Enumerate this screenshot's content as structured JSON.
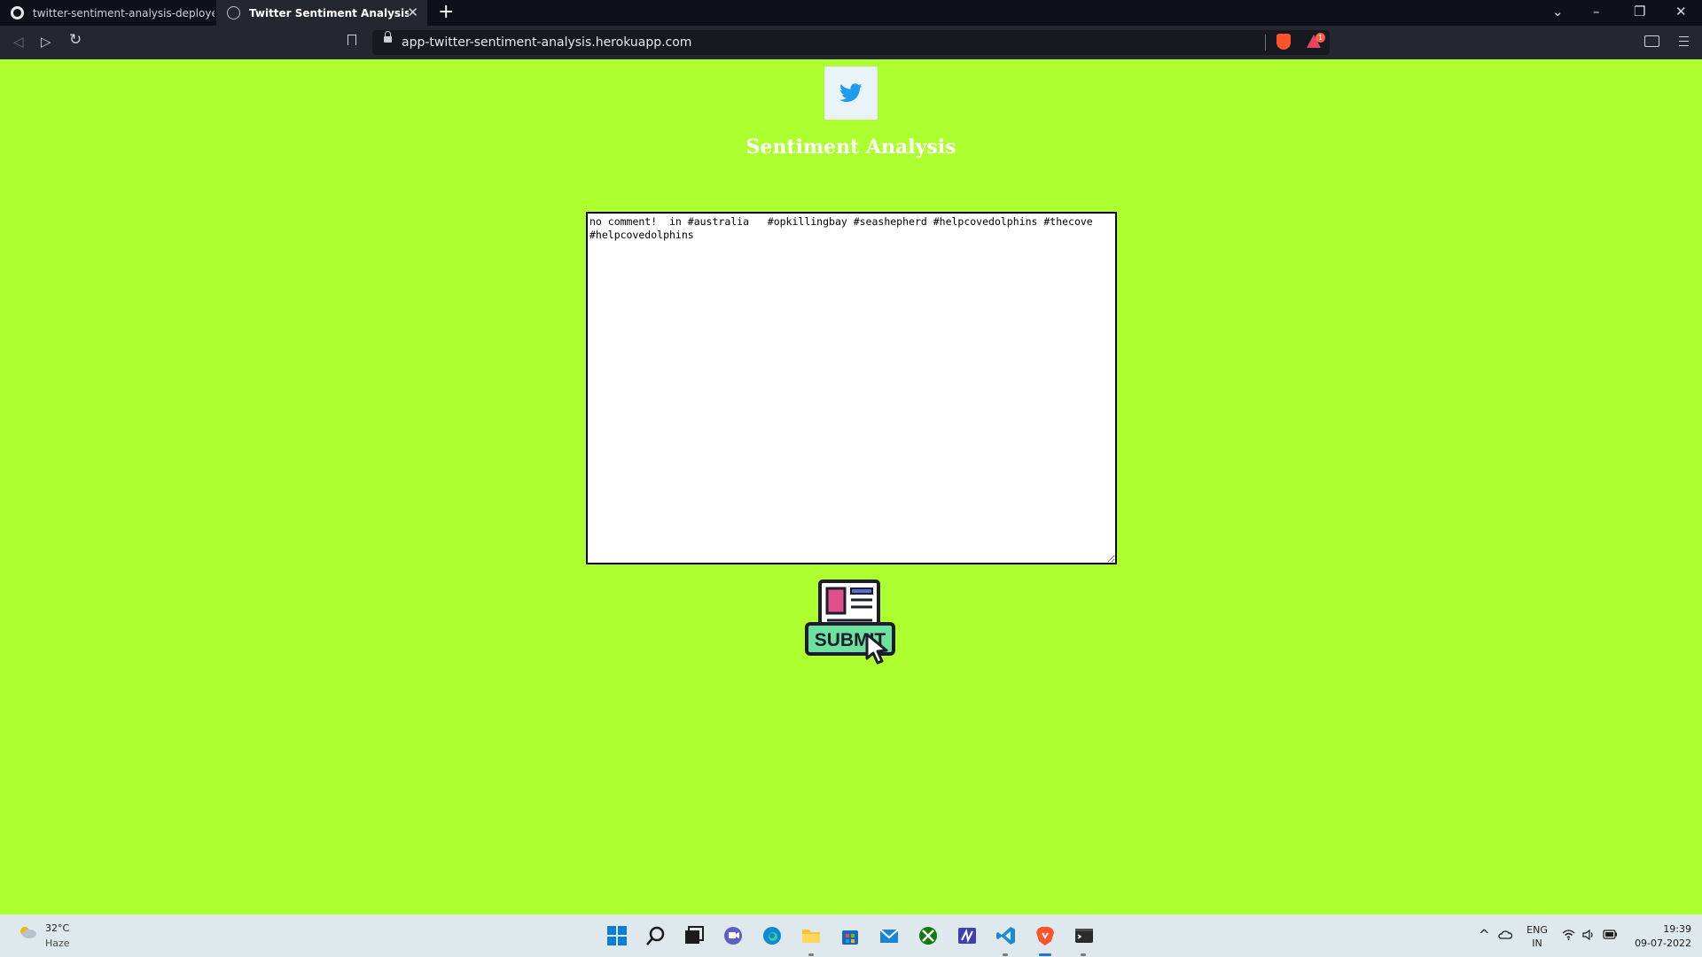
{
  "browser": {
    "tabs": [
      {
        "title": "twitter-sentiment-analysis-deployed/a",
        "active": false
      },
      {
        "title": "Twitter Sentiment Analysis",
        "active": true
      }
    ],
    "new_tab_label": "+",
    "url": "app-twitter-sentiment-analysis.herokuapp.com",
    "rewards_badge": "1"
  },
  "page": {
    "background": "#adff2f",
    "heading": "Sentiment Analysis",
    "tweet_input": {
      "value": "no comment!  in #australia   #opkillingbay #seashepherd #helpcovedolphins #thecove  #helpcovedolphins",
      "placeholder": ""
    },
    "submit_label": "SUBMIT"
  },
  "taskbar": {
    "weather_temp": "32°C",
    "weather_condition": "Haze",
    "language": "ENG",
    "region": "IN",
    "time": "19:39",
    "date": "09-07-2022",
    "pinned_apps": [
      "start-icon",
      "search-icon",
      "task-view-icon",
      "teams-chat-icon",
      "edge-icon",
      "file-explorer-icon",
      "store-icon",
      "mail-icon",
      "xbox-icon",
      "editor-icon",
      "vscode-icon",
      "brave-icon",
      "terminal-icon"
    ]
  }
}
